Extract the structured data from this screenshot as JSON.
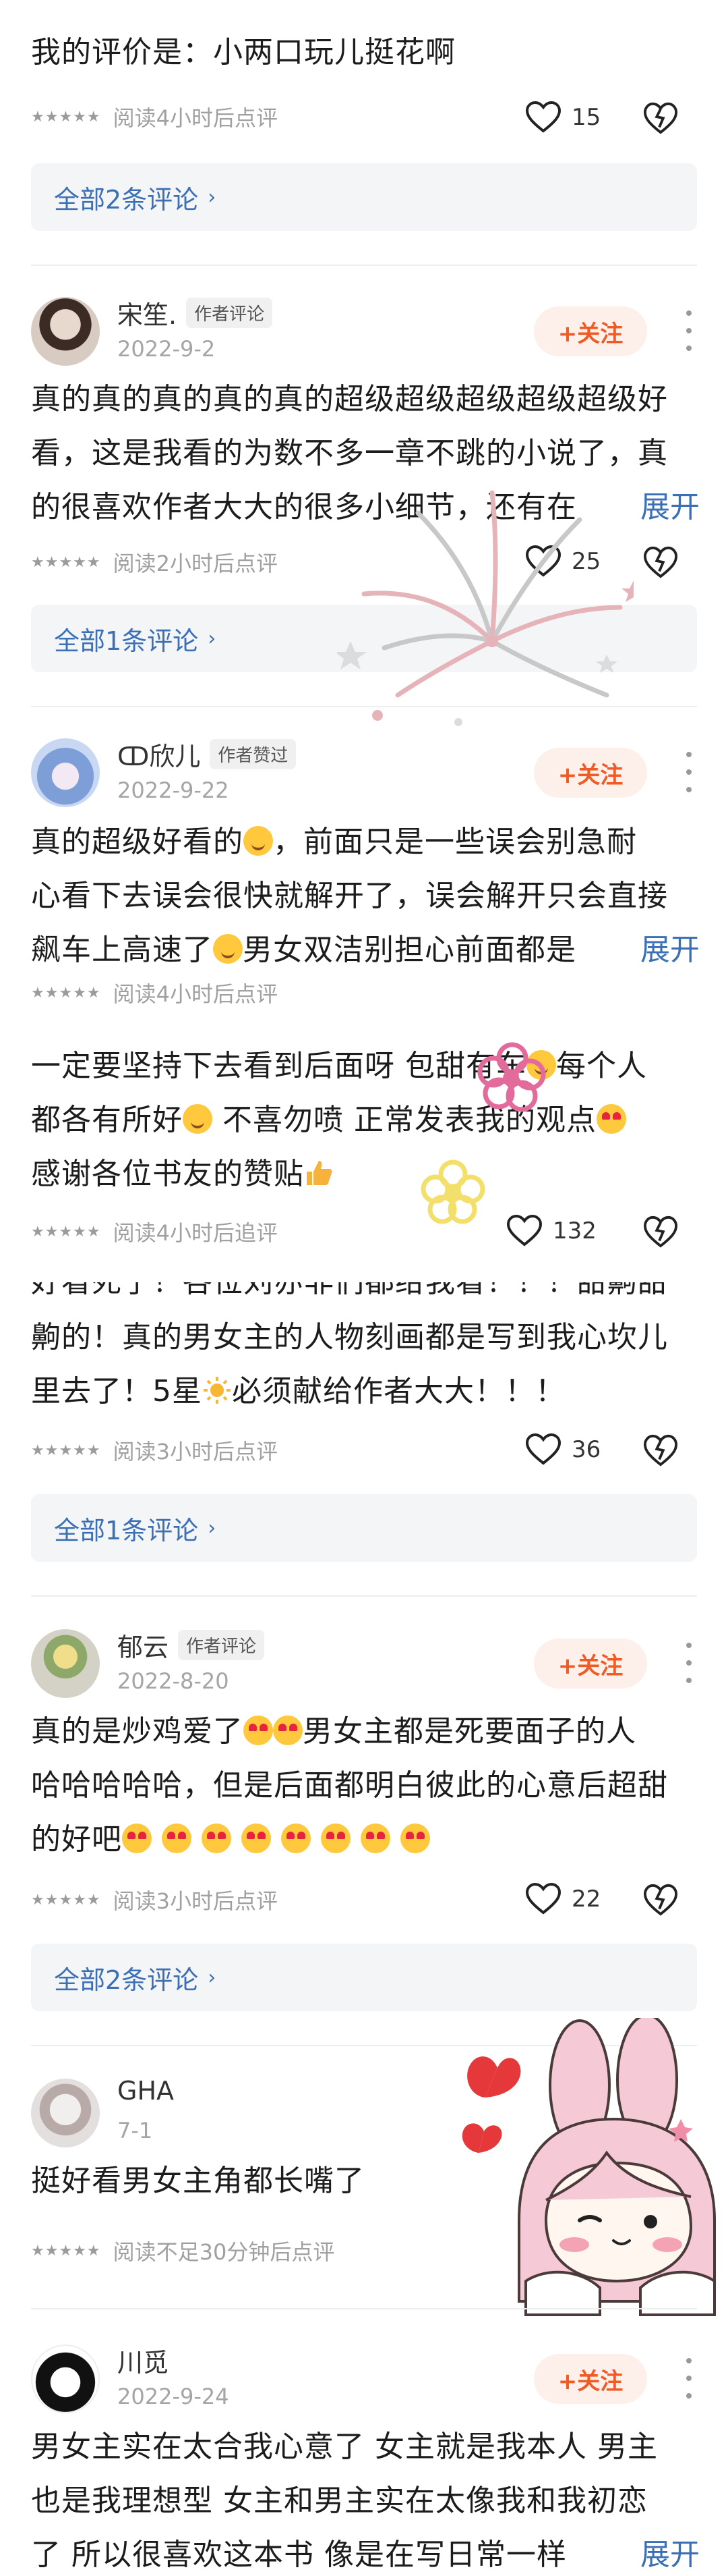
{
  "stars": "★★★★★",
  "review_top": {
    "text": "我的评价是：小两口玩儿挺花啊",
    "meta": "阅读4小时后点评",
    "likes": "15"
  },
  "sub_top": "全部2条评论",
  "c1": {
    "name": "宋笙.",
    "tag": "作者评论",
    "date": "2022-9-2",
    "follow": "+关注",
    "lines": [
      "真的真的真的真的真的超级超级超级超级超级好",
      "看，这是我看的为数不多一章不跳的小说了，真",
      "的很喜欢作者大大的很多小细节，还有在"
    ],
    "expand": "展开",
    "meta": "阅读2小时后点评",
    "likes": "25",
    "sub": "全部1条评论"
  },
  "c2": {
    "name": "ↀ欣儿",
    "tag": "作者赞过",
    "date": "2022-9-22",
    "follow": "+关注",
    "line1a": "真的超级好看的",
    "line1b": "，前面只是一些误会别急耐",
    "line2": "心看下去误会很快就解开了，误会解开只会直接",
    "line3a": "飙车上高速了",
    "line3b": "男女双洁别担心前面都是",
    "expand": "展开",
    "meta": "阅读4小时后点评"
  },
  "reply": {
    "line1a": "一定要坚持下去看到后面呀 包甜有车",
    "line1b": "每个人",
    "line2a": "都各有所好",
    "line2b": " 不喜勿喷 正常发表我的观点",
    "line3": "感谢各位书友的赞贴",
    "meta": "阅读4小时后追评",
    "likes": "132"
  },
  "c3": {
    "line0": "好看死了！各位刘亦非们都给我看！！！甜齁甜",
    "line1": "齁的！真的男女主的人物刻画都是写到我心坎儿",
    "line2a": "里去了！5星",
    "line2b": "必须献给作者大大！！！",
    "meta": "阅读3小时后点评",
    "likes": "36",
    "sub": "全部1条评论"
  },
  "c4": {
    "name": "郁云",
    "tag": "作者评论",
    "date": "2022-8-20",
    "follow": "+关注",
    "line1a": "真的是炒鸡爱了",
    "line1b": "男女主都是死要面子的人",
    "line2": "哈哈哈哈哈，但是后面都明白彼此的心意后超甜",
    "line3": "的好吧",
    "meta": "阅读3小时后点评",
    "likes": "22",
    "sub": "全部2条评论"
  },
  "c5": {
    "name": "GHA",
    "date": "7-1",
    "text": "挺好看男女主角都长嘴了",
    "meta": "阅读不足30分钟后点评"
  },
  "c6": {
    "name": "川觅",
    "date": "2022-9-24",
    "follow": "+关注",
    "lines": [
      "男女主实在太合我心意了 女主就是我本人 男主",
      "也是我理想型 女主和男主实在太像我和我初恋",
      "了 所以很喜欢这本书 像是在写日常一样"
    ],
    "expand": "展开"
  },
  "colors": {
    "accent": "#f05a24",
    "link": "#3b6fb6",
    "sub_bg": "#f4f5f7"
  }
}
